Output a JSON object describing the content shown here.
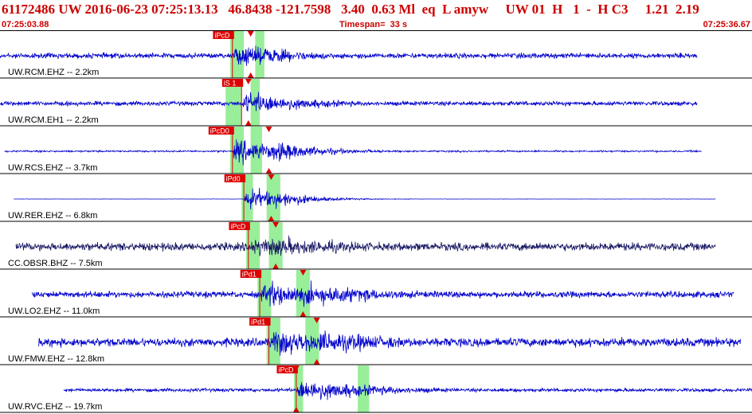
{
  "header": {
    "title": "61172486 UW 2016-06-23 07:25:13.13   46.8438 -121.7598   3.40  0.63 Ml  eq  L amyw     UW 01  H   1  -  H C3     1.21  2.19",
    "start_time": "07:25:03.88",
    "timespan": "Timespan=  33 s",
    "end_time": "07:25:36.67"
  },
  "colors": {
    "title": "#cc0000",
    "trace": "#0000cc",
    "trace_dark": "#1a1a66",
    "highlight": "#99ee99",
    "pick": "#dd0000",
    "frame": "#000000"
  },
  "chart_data": {
    "type": "line",
    "title": "61172486 UW 2016-06-23 07:25:13.13",
    "xlabel": "",
    "ylabel": "",
    "x_range": [
      "07:25:03.88",
      "07:25:36.67"
    ],
    "timespan_s": 33,
    "grid": false,
    "series": [
      {
        "name": "UW.RCM.EHZ -- 2.2km",
        "pick_label": "iPcD",
        "pick_time_s": 10.2,
        "s_time_s": 11.0,
        "windows_s": [
          [
            10.1,
            10.7
          ],
          [
            11.2,
            11.6
          ]
        ],
        "signal_end_s": 30.6,
        "signal_start_s": 0.0,
        "noise": 0.18,
        "peak": 0.85,
        "decay_s": 3.0,
        "color": "trace"
      },
      {
        "name": "UW.RCM.EH1 -- 2.2km",
        "pick_label": "iS 1",
        "pick_time_s": 10.6,
        "s_time_s": 10.9,
        "windows_s": [
          [
            9.9,
            10.6
          ],
          [
            11.0,
            11.4
          ]
        ],
        "signal_end_s": 30.6,
        "signal_start_s": 0.0,
        "noise": 0.15,
        "peak": 0.9,
        "decay_s": 3.0,
        "color": "trace"
      },
      {
        "name": "UW.RCS.EHZ -- 3.7km",
        "pick_label": "iPcD0",
        "pick_time_s": 10.2,
        "s_time_s": 11.8,
        "windows_s": [
          [
            10.1,
            10.7
          ],
          [
            11.0,
            11.5
          ]
        ],
        "signal_end_s": 30.8,
        "signal_start_s": 0.2,
        "noise": 0.06,
        "peak": 0.95,
        "decay_s": 2.6,
        "color": "trace"
      },
      {
        "name": "UW.RER.EHZ -- 6.8km",
        "pick_label": "iPd0",
        "pick_time_s": 10.7,
        "s_time_s": 11.9,
        "windows_s": [
          [
            10.6,
            11.1
          ],
          [
            11.7,
            12.3
          ]
        ],
        "signal_end_s": 31.4,
        "signal_start_s": 0.6,
        "noise": 0.01,
        "peak": 0.9,
        "decay_s": 1.8,
        "color": "trace"
      },
      {
        "name": "CC.OBSR.BHZ -- 7.5km",
        "pick_label": "iPcD",
        "pick_time_s": 10.9,
        "s_time_s": 12.1,
        "windows_s": [
          [
            10.8,
            11.4
          ],
          [
            11.8,
            12.4
          ]
        ],
        "signal_end_s": 31.4,
        "signal_start_s": 0.7,
        "noise": 0.28,
        "peak": 0.75,
        "decay_s": 6.0,
        "color": "trace_dark"
      },
      {
        "name": "UW.LO2.EHZ -- 11.0km",
        "pick_label": "iPd1",
        "pick_time_s": 11.4,
        "s_time_s": 13.3,
        "windows_s": [
          [
            11.3,
            11.9
          ],
          [
            13.0,
            13.6
          ]
        ],
        "signal_end_s": 32.2,
        "signal_start_s": 1.4,
        "noise": 0.22,
        "peak": 0.95,
        "decay_s": 5.0,
        "color": "trace"
      },
      {
        "name": "UW.FMW.EHZ -- 12.8km",
        "pick_label": "iPd1",
        "pick_time_s": 11.8,
        "s_time_s": 13.9,
        "windows_s": [
          [
            11.7,
            12.3
          ],
          [
            13.4,
            14.0
          ]
        ],
        "signal_end_s": 32.5,
        "signal_start_s": 1.7,
        "noise": 0.3,
        "peak": 1.0,
        "decay_s": 5.0,
        "color": "trace"
      },
      {
        "name": "UW.RVC.EHZ -- 19.7km",
        "pick_label": "iPcD",
        "pick_time_s": 13.0,
        "s_time_s": 13.0,
        "windows_s": [
          [
            12.9,
            13.3
          ],
          [
            15.7,
            16.2
          ]
        ],
        "signal_end_s": 33.0,
        "signal_start_s": 2.8,
        "noise": 0.12,
        "peak": 0.9,
        "decay_s": 3.5,
        "color": "trace"
      }
    ]
  }
}
